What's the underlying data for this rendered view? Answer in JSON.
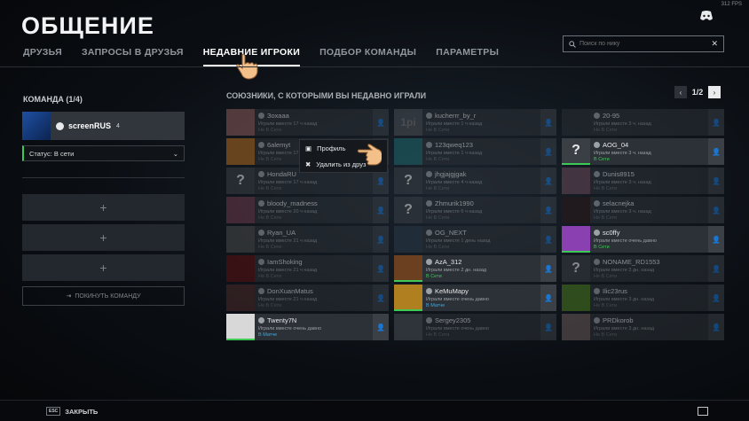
{
  "fps": "312 FPS",
  "title": "ОБЩЕНИЕ",
  "tabs": [
    "ДРУЗЬЯ",
    "ЗАПРОСЫ В ДРУЗЬЯ",
    "НЕДАВНИЕ ИГРОКИ",
    "ПОДБОР КОМАНДЫ",
    "ПАРАМЕТРЫ"
  ],
  "active_tab": 2,
  "search": {
    "placeholder": "Поиск по нику"
  },
  "team": {
    "heading": "КОМАНДА (1/4)",
    "me": {
      "name": "screenRUS",
      "level": "4"
    },
    "status": "Статус: В сети",
    "leave": "ПОКИНУТЬ КОМАНДУ"
  },
  "allies_heading": "СОЮЗНИКИ, С КОТОРЫМИ ВЫ НЕДАВНО ИГРАЛИ",
  "pager": {
    "label": "1/2"
  },
  "context_menu": {
    "profile": "Профиль",
    "remove": "Удалить из друз"
  },
  "columns": [
    [
      {
        "name": "Зохааа",
        "played": "Играли вместе 17 ч назад",
        "status": "Не В Сети",
        "av": "#8a5a5a",
        "st": "off",
        "dim": true
      },
      {
        "name": "6alemyt",
        "played": "Играли вместе 17 ч назад",
        "status": "Не В Сети",
        "av": "#b06a20",
        "st": "off",
        "dim": true
      },
      {
        "name": "HondaRU",
        "played": "Играли вместе 17 ч назад",
        "status": "Не В Сети",
        "av": "#3a3f45",
        "st": "off",
        "dim": true,
        "q": true
      },
      {
        "name": "bloody_madness",
        "played": "Играли вместе 20 ч назад",
        "status": "Не В Сети",
        "av": "#6a3a4a",
        "st": "off",
        "dim": true
      },
      {
        "name": "Ryan_UA",
        "played": "Играли вместе 21 ч назад",
        "status": "Не В Сети",
        "av": "#4a4a4a",
        "st": "off",
        "dim": true
      },
      {
        "name": "IamShoking",
        "played": "Играли вместе 21 ч назад",
        "status": "Не В Сети",
        "av": "#5a1010",
        "st": "off",
        "dim": true
      },
      {
        "name": "DonXuanMatus",
        "played": "Играли вместе 21 ч назад",
        "status": "Не В Сети",
        "av": "#4a2a2a",
        "st": "off",
        "dim": true
      },
      {
        "name": "Twenty7N",
        "played": "Играли вместе очень давно",
        "status": "В Матче",
        "av": "#d8d8d8",
        "st": "match",
        "dim": false
      }
    ],
    [
      {
        "name": "kucherrr_by_r",
        "played": "Играли вместе 1 ч назад",
        "status": "Не В Сети",
        "av": "#4a4f55",
        "st": "off",
        "dim": true,
        "txt": "1pi"
      },
      {
        "name": "123qweq123",
        "played": "Играли вместе 1 ч назад",
        "status": "Не В Сети",
        "av": "#1f6a70",
        "st": "off",
        "dim": true
      },
      {
        "name": "jhgjajgjgak",
        "played": "Играли вместе 4 ч назад",
        "status": "Не В Сети",
        "av": "#3a3f45",
        "st": "off",
        "dim": true,
        "q": true
      },
      {
        "name": "Zhmurik1990",
        "played": "Играли вместе 6 ч назад",
        "status": "Не В Сети",
        "av": "#3a3f45",
        "st": "off",
        "dim": true,
        "q": true
      },
      {
        "name": "OG_NEXT",
        "played": "Играли вместе 1 день назад",
        "status": "Не В Сети",
        "av": "#2a3a4a",
        "st": "off",
        "dim": true
      },
      {
        "name": "AzA_312",
        "played": "Играли вместе 2 дн. назад",
        "status": "В Сети",
        "av": "#6a4020",
        "st": "on",
        "dim": false
      },
      {
        "name": "KeMuMapy",
        "played": "Играли вместе очень давно",
        "status": "В Матче",
        "av": "#b08020",
        "st": "match",
        "dim": false
      },
      {
        "name": "Sergey2305",
        "played": "Играли вместе очень давно",
        "status": "Не В Сети",
        "av": "#4a4f55",
        "st": "off",
        "dim": true
      }
    ],
    [
      {
        "name": "20-95",
        "played": "Играли вместе 3 ч. назад",
        "status": "Не В Сети",
        "av": "#2a2f35",
        "st": "off",
        "dim": true
      },
      {
        "name": "AOG_04",
        "played": "Играли вместе 3 ч. назад",
        "status": "В Сети",
        "av": "#3a3f45",
        "st": "on",
        "dim": false,
        "q": true
      },
      {
        "name": "Dunis8915",
        "played": "Играли вместе 3 ч. назад",
        "status": "Не В Сети",
        "av": "#6a4a5a",
        "st": "off",
        "dim": true
      },
      {
        "name": "selacnejka",
        "played": "Играли вместе 3 ч. назад",
        "status": "Не В Сети",
        "av": "#2a1a1a",
        "st": "off",
        "dim": true
      },
      {
        "name": "sc0ffy",
        "played": "Играли вместе очень давно",
        "status": "В Сети",
        "av": "#8a40b0",
        "st": "on",
        "dim": false
      },
      {
        "name": "NONAME_RD1553",
        "played": "Играли вместе 3 дн. назад",
        "status": "Не В Сети",
        "av": "#3a3f45",
        "st": "off",
        "dim": true,
        "q": true
      },
      {
        "name": "Ilic23rus",
        "played": "Играли вместе 3 дн. назад",
        "status": "Не В Сети",
        "av": "#4a7a20",
        "st": "off",
        "dim": true
      },
      {
        "name": "PRDkorob",
        "played": "Играли вместе 3 дн. назад",
        "status": "Не В Сети",
        "av": "#6a5a5a",
        "st": "off",
        "dim": true
      }
    ]
  ],
  "bottom": {
    "close_key": "ESC",
    "close": "ЗАКРЫТЬ"
  }
}
